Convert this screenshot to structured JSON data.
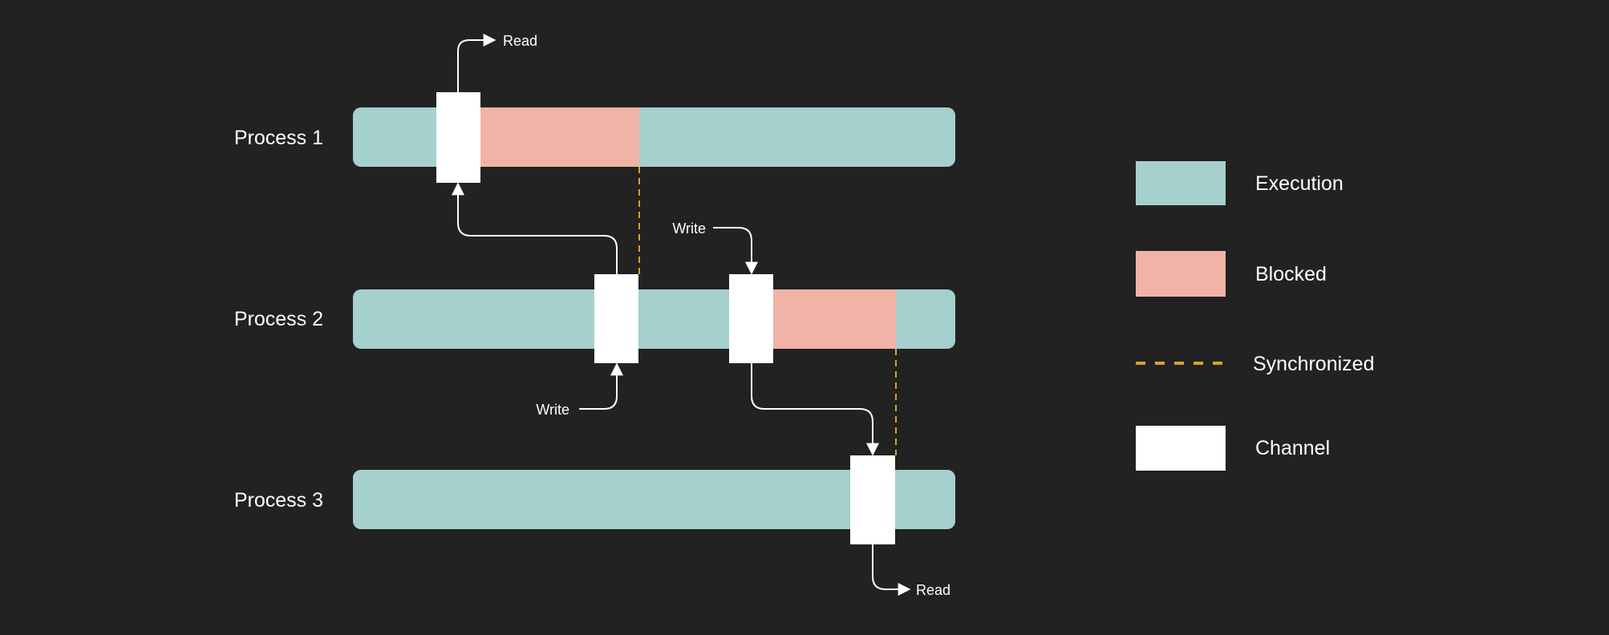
{
  "colors": {
    "background": "#222222",
    "execution": "#a5d0cd",
    "blocked": "#f2b3a7",
    "synchronized": "#d9a12b",
    "channel": "#ffffff"
  },
  "processes": [
    {
      "label": "Process 1"
    },
    {
      "label": "Process 2"
    },
    {
      "label": "Process 3"
    }
  ],
  "annotations": {
    "read_top": "Read",
    "write_p2_left": "Write",
    "write_p2_right": "Write",
    "read_bottom": "Read"
  },
  "legend": [
    {
      "label": "Execution",
      "kind": "execution"
    },
    {
      "label": "Blocked",
      "kind": "blocked"
    },
    {
      "label": "Synchronized",
      "kind": "synchronized"
    },
    {
      "label": "Channel",
      "kind": "channel"
    }
  ]
}
